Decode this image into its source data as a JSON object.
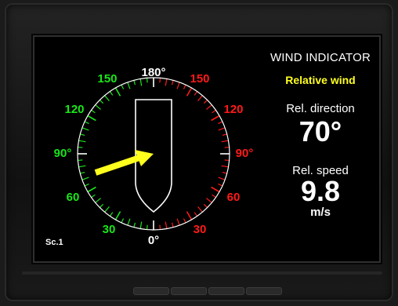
{
  "panel": {
    "title": "WIND INDICATOR",
    "subtitle": "Relative wind",
    "direction_label": "Rel. direction",
    "direction_value": "70°",
    "speed_label": "Rel. speed",
    "speed_value": "9.8",
    "speed_unit": "m/s"
  },
  "dial": {
    "wind_direction_deg": 70,
    "labels_left": [
      "150",
      "120",
      "90°",
      "60",
      "30"
    ],
    "labels_right": [
      "150",
      "120",
      "90°",
      "60",
      "30"
    ],
    "label_top": "180°",
    "label_bottom": "0°"
  },
  "scale_label": "Sc.1",
  "colors": {
    "starboard": "#ff1a1a",
    "port": "#19e619",
    "arrow": "#ffff1e",
    "text": "#ffffff"
  },
  "icons": {
    "ship": "ship-outline-icon",
    "arrow": "wind-arrow-icon"
  }
}
